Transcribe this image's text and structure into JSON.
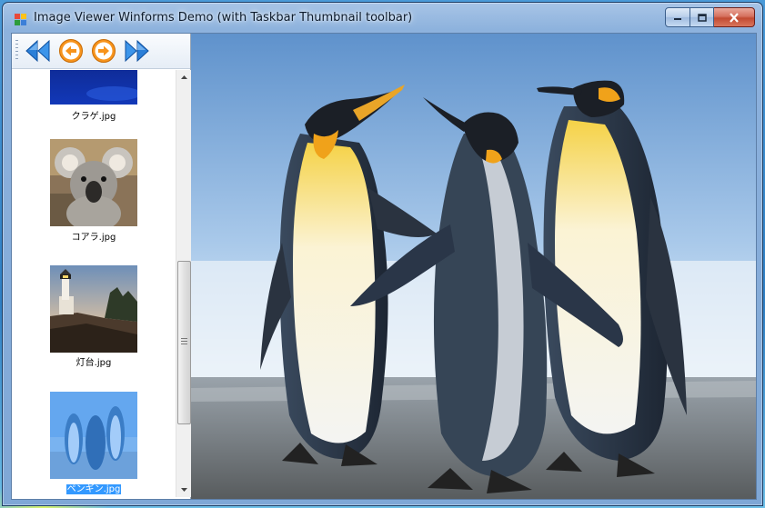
{
  "window": {
    "title": "Image Viewer Winforms Demo (with Taskbar Thumbnail toolbar)"
  },
  "toolbar": {
    "buttons": [
      {
        "name": "first-button",
        "icon": "double-left-arrow-icon"
      },
      {
        "name": "previous-button",
        "icon": "circle-left-arrow-icon"
      },
      {
        "name": "next-button",
        "icon": "circle-right-arrow-icon"
      },
      {
        "name": "last-button",
        "icon": "double-right-arrow-icon"
      }
    ]
  },
  "thumbnails": [
    {
      "label": "クラゲ.jpg",
      "selected": false
    },
    {
      "label": "コアラ.jpg",
      "selected": false
    },
    {
      "label": "灯台.jpg",
      "selected": false
    },
    {
      "label": "ペンギン.jpg",
      "selected": true
    }
  ],
  "colors": {
    "selection": "#3399ff",
    "toolbar_arrow": "#2b7fd8",
    "nav_circle": "#f7941d"
  }
}
